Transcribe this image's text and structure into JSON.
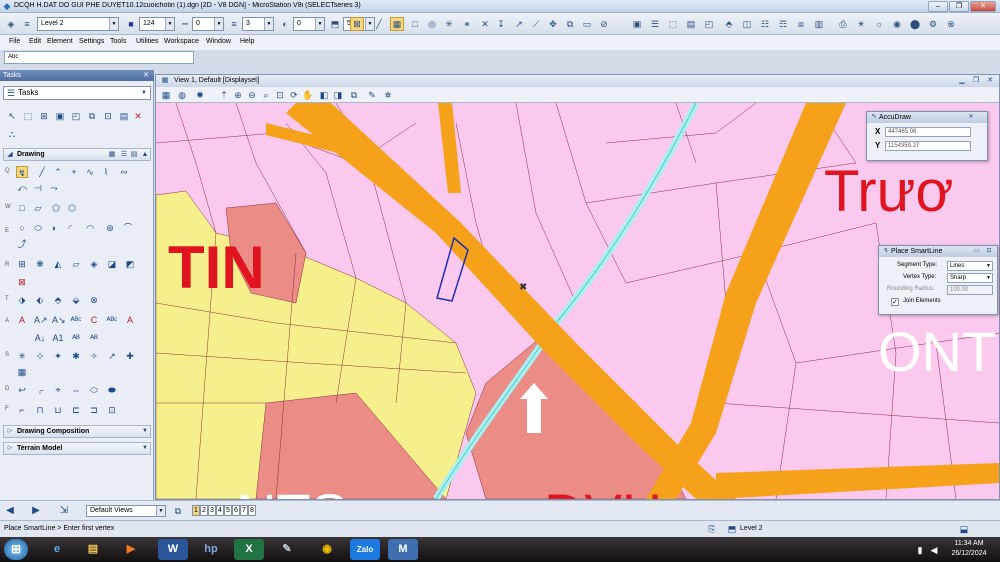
{
  "window": {
    "title": "DCQH H.DAT DO GUI PHỀ DUYỆT10.12cuoichotin (1).dgn [2D - V8 DGN] - MicroStation V8i (SELECTseries 3)",
    "min": "–",
    "max": "❐",
    "close": "✕"
  },
  "attributes": {
    "level": "Level 2",
    "color": "124",
    "style": "0",
    "weight": "3",
    "transparency": "0",
    "priority": "500"
  },
  "menu": [
    "File",
    "Edit",
    "Element",
    "Settings",
    "Tools",
    "Utilities",
    "Workspace",
    "Window",
    "Help"
  ],
  "keyin": "Abc",
  "tasks": {
    "title": "Tasks",
    "combo": "Tasks",
    "drawing": "Drawing",
    "row_keys": [
      "Q",
      "W",
      "E",
      "R",
      "T",
      "A",
      "S",
      "D",
      "F"
    ],
    "drawing_composition": "Drawing Composition",
    "terrain_model": "Terrain Model"
  },
  "view": {
    "title": "View 1, Default [Displayset]"
  },
  "map": {
    "label_tin": "TIN",
    "label_truong": "Trươ",
    "label_ont": "ONT",
    "label_nts": "NTS",
    "label_dvh": "DVH",
    "colors": {
      "background": "#fbc8ee",
      "yellow_zone": "#f6f08c",
      "salmon_zone": "#ec8c86",
      "road": "#f6a11a",
      "river": "#a6f0ef",
      "label_red": "#e0141e",
      "lines": "#8b2f3d"
    }
  },
  "accudraw": {
    "title": "AccuDraw",
    "x_label": "X",
    "x_value": "447465.08",
    "y_label": "Y",
    "y_value": "1154359.27"
  },
  "smartline": {
    "title": "Place SmartLine",
    "segment_type_label": "Segment Type:",
    "segment_type": "Lines",
    "vertex_type_label": "Vertex Type:",
    "vertex_type": "Sharp",
    "rounding_radius_label": "Rounding Radius:",
    "rounding_radius": "100.00",
    "join_elements": "Join Elements"
  },
  "view_nav": {
    "views_combo": "Default Views",
    "view_numbers": [
      "1",
      "2",
      "3",
      "4",
      "5",
      "6",
      "7",
      "8"
    ]
  },
  "status": {
    "prompt": "Place SmartLine > Enter first vertex",
    "level": "Level 2"
  },
  "taskbar": {
    "time": "11:34 AM",
    "date": "26/12/2024"
  }
}
